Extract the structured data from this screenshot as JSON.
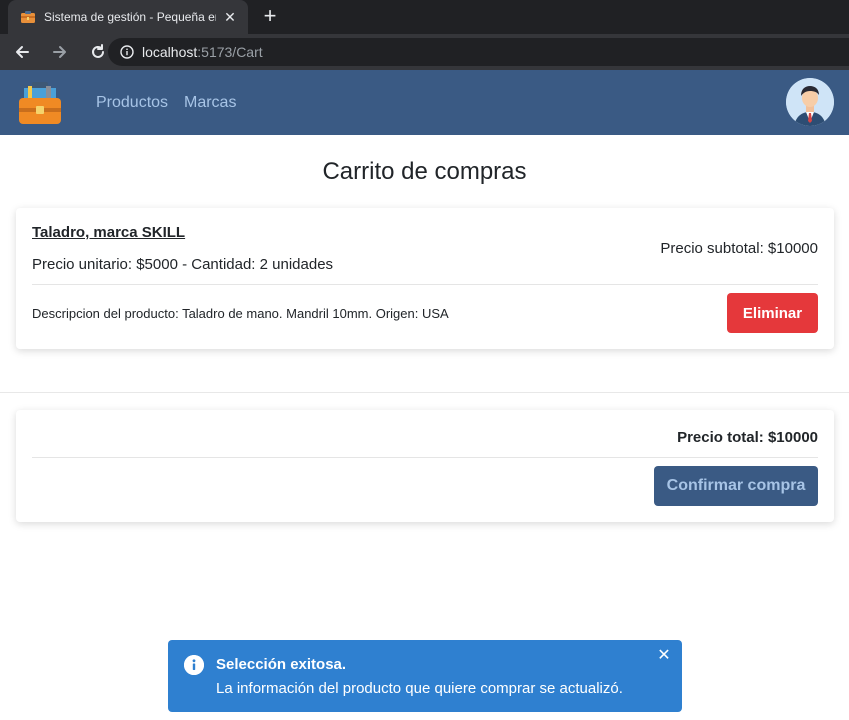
{
  "browser": {
    "tab_title": "Sistema de gestión - Pequeña em",
    "tab_close": "✕",
    "new_tab": "+",
    "url_host": "localhost",
    "url_path": ":5173/Cart"
  },
  "navbar": {
    "links": [
      "Productos",
      "Marcas"
    ]
  },
  "cart": {
    "title": "Carrito de compras",
    "items": [
      {
        "name": "Taladro, marca SKILL",
        "meta": "Precio unitario: $5000 - Cantidad: 2 unidades",
        "subtotal": "Precio subtotal: $10000",
        "description": "Descripcion del producto: Taladro de mano. Mandril 10mm. Origen: USA",
        "delete_label": "Eliminar"
      }
    ],
    "total": "Precio total: $10000",
    "confirm_label": "Confirmar compra"
  },
  "toast": {
    "title": "Selección exitosa.",
    "message": "La información del producto que quiere comprar se actualizó.",
    "close": "✕"
  },
  "colors": {
    "navbar": "#3a5a84",
    "nav_link": "#a7c4e6",
    "danger": "#e5383b",
    "info": "#2f80d0"
  }
}
